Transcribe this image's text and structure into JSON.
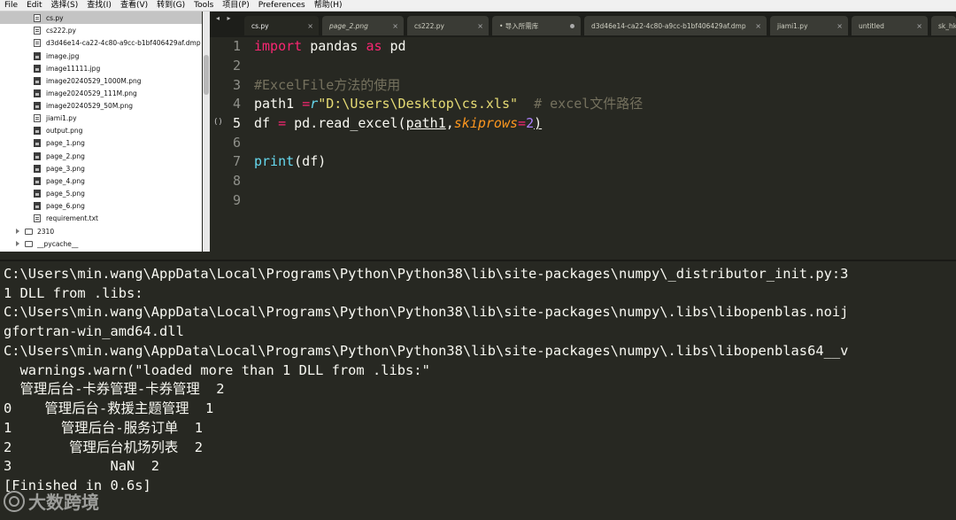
{
  "menu": [
    "File",
    "Edit",
    "选择(S)",
    "查找(I)",
    "查看(V)",
    "转到(G)",
    "Tools",
    "项目(P)",
    "Preferences",
    "帮助(H)"
  ],
  "sidebar": {
    "files": [
      {
        "name": "cs.py",
        "icon": "python-file-icon",
        "selected": true
      },
      {
        "name": "cs222.py",
        "icon": "python-file-icon"
      },
      {
        "name": "d3d46e14-ca22-4c80-a9cc-b1bf406429af.dmp",
        "icon": "file-icon"
      },
      {
        "name": "image.jpg",
        "icon": "image-file-icon"
      },
      {
        "name": "image11111.jpg",
        "icon": "image-file-icon"
      },
      {
        "name": "image20240529_1000M.png",
        "icon": "image-file-icon"
      },
      {
        "name": "image20240529_111M.png",
        "icon": "image-file-icon"
      },
      {
        "name": "image20240529_50M.png",
        "icon": "image-file-icon"
      },
      {
        "name": "jiami1.py",
        "icon": "python-file-icon"
      },
      {
        "name": "output.png",
        "icon": "image-file-icon"
      },
      {
        "name": "page_1.png",
        "icon": "image-file-icon"
      },
      {
        "name": "page_2.png",
        "icon": "image-file-icon"
      },
      {
        "name": "page_3.png",
        "icon": "image-file-icon"
      },
      {
        "name": "page_4.png",
        "icon": "image-file-icon"
      },
      {
        "name": "page_5.png",
        "icon": "image-file-icon"
      },
      {
        "name": "page_6.png",
        "icon": "image-file-icon"
      },
      {
        "name": "requirement.txt",
        "icon": "text-file-icon"
      }
    ],
    "folders": [
      {
        "name": "2310"
      },
      {
        "name": "__pycache__"
      }
    ]
  },
  "tabs": [
    {
      "label": "cs.py",
      "active": true,
      "close": "×"
    },
    {
      "label": "page_2.png",
      "italic": true,
      "close": "×"
    },
    {
      "label": "cs222.py",
      "close": "×"
    },
    {
      "label": "• 导入所需库",
      "modified": true
    },
    {
      "label": "d3d46e14-ca22-4c80-a9cc-b1bf406429af.dmp",
      "close": "×"
    },
    {
      "label": "jiami1.py",
      "close": "×"
    },
    {
      "label": "untitled",
      "close": "×"
    },
    {
      "label": "sk_hk",
      "close": ""
    }
  ],
  "tab_nav": "◂ ▸",
  "editor": {
    "line_numbers": [
      "1",
      "2",
      "3",
      "4",
      "5",
      "6",
      "7",
      "8",
      "9"
    ],
    "fold_marker": "()",
    "code": {
      "l1_kw1": "import",
      "l1_mod": " pandas ",
      "l1_kw2": "as",
      "l1_alias": " pd",
      "l3_comment": "#ExcelFile方法的使用",
      "l4_var": "path1 ",
      "l4_op": "=",
      "l4_prefix": "r",
      "l4_str": "\"D:\\Users\\Desktop\\cs.xls\"",
      "l4_comment": "  # excel文件路径",
      "l5_a": "df ",
      "l5_op": "=",
      "l5_b": " pd.read_excel(",
      "l5_arg": "path1",
      "l5_comma": ",",
      "l5_param": "skiprows",
      "l5_eq": "=",
      "l5_num": "2",
      "l5_close": ")",
      "l7_fn": "print",
      "l7_rest": "(df)"
    }
  },
  "console": {
    "lines": [
      "C:\\Users\\min.wang\\AppData\\Local\\Programs\\Python\\Python38\\lib\\site-packages\\numpy\\_distributor_init.py:3",
      "1 DLL from .libs:",
      "C:\\Users\\min.wang\\AppData\\Local\\Programs\\Python\\Python38\\lib\\site-packages\\numpy\\.libs\\libopenblas.noij",
      "gfortran-win_amd64.dll",
      "C:\\Users\\min.wang\\AppData\\Local\\Programs\\Python\\Python38\\lib\\site-packages\\numpy\\.libs\\libopenblas64__v",
      "  warnings.warn(\"loaded more than 1 DLL from .libs:\"",
      "  管理后台-卡券管理-卡券管理  2",
      "0    管理后台-救援主题管理  1",
      "1      管理后台-服务订单  1",
      "2       管理后台机场列表  2",
      "3            NaN  2",
      "[Finished in 0.6s]"
    ]
  },
  "watermark": {
    "text": "大数跨境"
  }
}
